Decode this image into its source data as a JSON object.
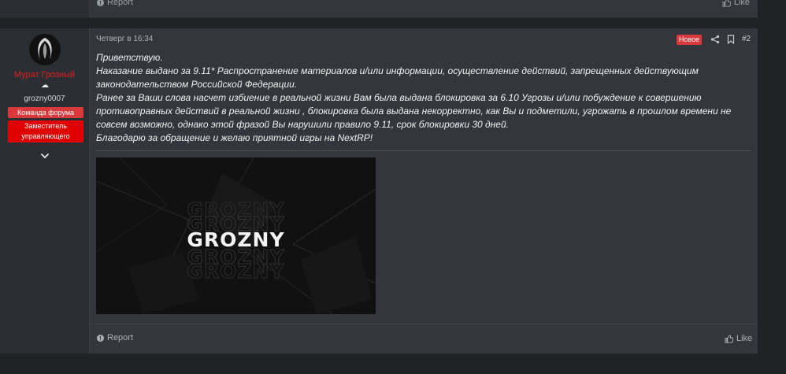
{
  "previous_post": {
    "report_label": "Report",
    "like_label": "Like"
  },
  "author": {
    "username": "Мурат Грозный",
    "user_title": "grozny0007",
    "banners": [
      "Команда форума",
      "Заместитель управляющего"
    ],
    "username_color": "#e0201f"
  },
  "post": {
    "date": "Четверг в 16:34",
    "new_label": "Новое",
    "number": "#2",
    "message_lines": [
      "Приветствую.",
      "Наказание выдано за 9.11* Распространение материалов и/или информации, осуществление действий, запрещенных действующим законодательством Российской Федерации.",
      "Ранее за Ваши слова насчет избиение в реальной жизни Вам была выдана блокировка за 6.10 Угрозы и/или побуждение к совершению противоправных действий в реальной жизни , блокировка была выдана некорректно, как Вы и подметили, угрожать в прошлом времени не совсем возможно, однако этой фразой Вы нарушили правило 9.11, срок блокировки 30 дней.",
      "Благодарю за обращение и желаю приятной игры на NextRP!"
    ],
    "image_text": "GROZNY",
    "report_label": "Report",
    "like_label": "Like"
  },
  "colors": {
    "page_bg": "#202226",
    "post_bg": "#33363c",
    "sidebar_bg": "#2b2e33",
    "accent_red": "#d9393a"
  }
}
